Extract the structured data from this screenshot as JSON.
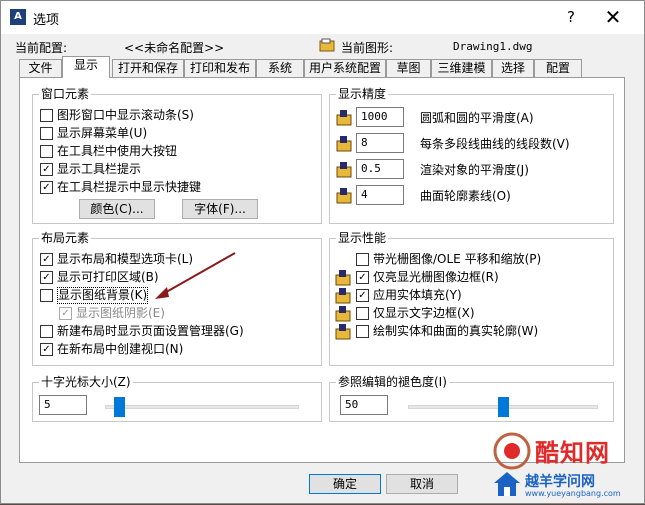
{
  "window": {
    "title": "选项",
    "help": "?",
    "close": "✕"
  },
  "header": {
    "current_profile_label": "当前配置:",
    "current_profile_value": "<<未命名配置>>",
    "current_drawing_label": "当前图形:",
    "current_drawing_value": "Drawing1.dwg"
  },
  "tabs": [
    "文件",
    "显示",
    "打开和保存",
    "打印和发布",
    "系统",
    "用户系统配置",
    "草图",
    "三维建模",
    "选择",
    "配置"
  ],
  "active_tab": 1,
  "window_elements": {
    "title": "窗口元素",
    "items": [
      {
        "label": "图形窗口中显示滚动条(S)",
        "checked": false
      },
      {
        "label": "显示屏幕菜单(U)",
        "checked": false
      },
      {
        "label": "在工具栏中使用大按钮",
        "checked": false
      },
      {
        "label": "显示工具栏提示",
        "checked": true
      },
      {
        "label": "在工具栏提示中显示快捷键",
        "checked": true
      }
    ],
    "colors_button": "颜色(C)...",
    "fonts_button": "字体(F)..."
  },
  "display_resolution": {
    "title": "显示精度",
    "items": [
      {
        "value": "1000",
        "label": "圆弧和圆的平滑度(A)"
      },
      {
        "value": "8",
        "label": "每条多段线曲线的线段数(V)"
      },
      {
        "value": "0.5",
        "label": "渲染对象的平滑度(J)"
      },
      {
        "value": "4",
        "label": "曲面轮廓素线(O)"
      }
    ]
  },
  "layout_elements": {
    "title": "布局元素",
    "items": [
      {
        "label": "显示布局和模型选项卡(L)",
        "checked": true,
        "disabled": false,
        "indent": false
      },
      {
        "label": "显示可打印区域(B)",
        "checked": true,
        "disabled": false,
        "indent": false
      },
      {
        "label": "显示图纸背景(K)",
        "checked": false,
        "disabled": false,
        "indent": false
      },
      {
        "label": "显示图纸阴影(E)",
        "checked": true,
        "disabled": true,
        "indent": true
      },
      {
        "label": "新建布局时显示页面设置管理器(G)",
        "checked": false,
        "disabled": false,
        "indent": false
      },
      {
        "label": "在新布局中创建视口(N)",
        "checked": true,
        "disabled": false,
        "indent": false
      }
    ]
  },
  "display_performance": {
    "title": "显示性能",
    "items": [
      {
        "label": "带光栅图像/OLE 平移和缩放(P)",
        "checked": false
      },
      {
        "label": "仅亮显光栅图像边框(R)",
        "checked": true
      },
      {
        "label": "应用实体填充(Y)",
        "checked": true
      },
      {
        "label": "仅显示文字边框(X)",
        "checked": false
      },
      {
        "label": "绘制实体和曲面的真实轮廓(W)",
        "checked": false
      }
    ]
  },
  "crosshair": {
    "title": "十字光标大小(Z)",
    "value": "5",
    "slider_fraction": 0.05
  },
  "xref_fade": {
    "title": "参照编辑的褪色度(I)",
    "value": "50",
    "slider_fraction": 0.5
  },
  "buttons": {
    "ok": "确定",
    "cancel": "取消"
  },
  "watermark": {
    "brand": "酷知网",
    "site": "越羊学问网",
    "url": "www.yueyangbang.com"
  },
  "colors": {
    "accent": "#0078d7",
    "annotation_arrow": "#8b1a1a",
    "watermark_red": "#e02a2a",
    "watermark_blue": "#1a62c4"
  }
}
